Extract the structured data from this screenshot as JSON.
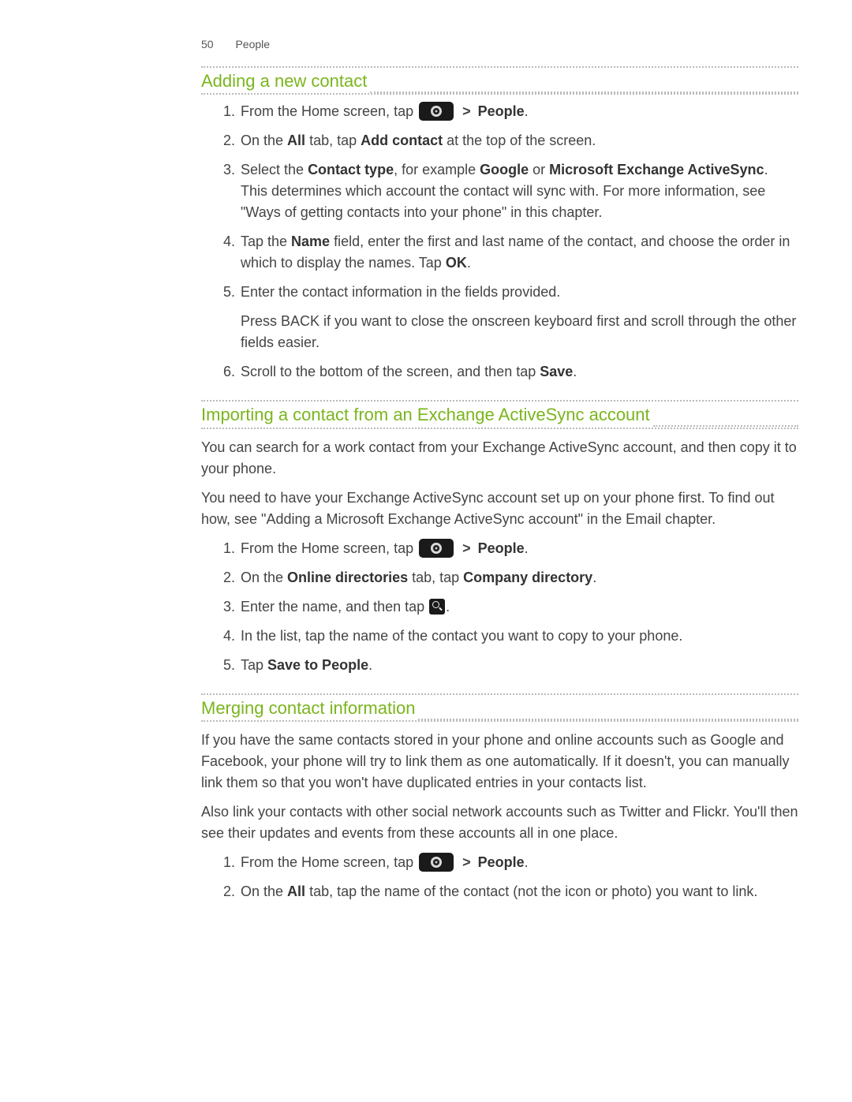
{
  "header": {
    "page_number": "50",
    "chapter": "People"
  },
  "sections": {
    "s1": {
      "title": "Adding a new contact",
      "steps": {
        "i1_pre": "From the Home screen, tap ",
        "i1_gt": ">",
        "i1_people": "People",
        "i1_post": ".",
        "i2_a": "On the ",
        "i2_all": "All",
        "i2_b": " tab, tap ",
        "i2_add": "Add contact",
        "i2_c": " at the top of the screen.",
        "i3_a": "Select the ",
        "i3_ct": "Contact type",
        "i3_b": ", for example ",
        "i3_google": "Google",
        "i3_c": " or ",
        "i3_meas": "Microsoft Exchange ActiveSync",
        "i3_d": ". This determines which account the contact will sync with. For more information, see \"Ways of getting contacts into your phone\" in this chapter.",
        "i4_a": "Tap the ",
        "i4_name": "Name",
        "i4_b": " field, enter the first and last name of the contact, and choose the order in which to display the names. Tap ",
        "i4_ok": "OK",
        "i4_c": ".",
        "i5": "Enter the contact information in the fields provided.",
        "i5_sub": "Press BACK if you want to close the onscreen keyboard first and scroll through the other fields easier.",
        "i6_a": "Scroll to the bottom of the screen, and then tap ",
        "i6_save": "Save",
        "i6_b": "."
      }
    },
    "s2": {
      "title": "Importing a contact from an Exchange ActiveSync account",
      "p1": "You can search for a work contact from your Exchange ActiveSync account, and then copy it to your phone.",
      "p2": "You need to have your Exchange ActiveSync account set up on your phone first. To find out how, see \"Adding a Microsoft Exchange ActiveSync account\" in the Email chapter.",
      "steps": {
        "i1_pre": "From the Home screen, tap ",
        "i1_gt": ">",
        "i1_people": "People",
        "i1_post": ".",
        "i2_a": "On the ",
        "i2_tab": "Online directories",
        "i2_b": " tab, tap ",
        "i2_cd": "Company directory",
        "i2_c": ".",
        "i3_a": "Enter the name, and then tap ",
        "i3_b": ".",
        "i4": "In the list, tap the name of the contact you want to copy to your phone.",
        "i5_a": "Tap ",
        "i5_stp": "Save to People",
        "i5_b": "."
      }
    },
    "s3": {
      "title": "Merging contact information",
      "p1": "If you have the same contacts stored in your phone and online accounts such as Google and Facebook, your phone will try to link them as one automatically. If it doesn't, you can manually link them so that you won't have duplicated entries in your contacts list.",
      "p2": "Also link your contacts with other social network accounts such as Twitter and Flickr. You'll then see their updates and events from these accounts all in one place.",
      "steps": {
        "i1_pre": "From the Home screen, tap ",
        "i1_gt": ">",
        "i1_people": "People",
        "i1_post": ".",
        "i2_a": "On the ",
        "i2_all": "All",
        "i2_b": " tab, tap the name of the contact (not the icon or photo) you want to link."
      }
    }
  }
}
